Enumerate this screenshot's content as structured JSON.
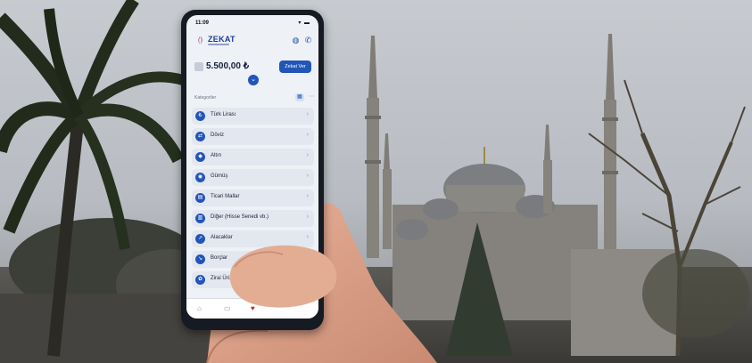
{
  "phone": {
    "status_time": "11:09",
    "status_icons": "▾ ▬",
    "brand": {
      "name": "ZEKAT"
    },
    "header_icons": [
      "globe-icon",
      "phone-icon"
    ],
    "balance": {
      "amount": "5.500,00 ₺",
      "button_label": "Zekat Ver"
    },
    "section_label": "Kategoriler",
    "categories": [
      {
        "label": "Türk Lirası",
        "icon": "lira-icon"
      },
      {
        "label": "Döviz",
        "icon": "currency-exchange-icon"
      },
      {
        "label": "Altın",
        "icon": "gold-icon"
      },
      {
        "label": "Gümüş",
        "icon": "silver-icon"
      },
      {
        "label": "Ticari Mallar",
        "icon": "commercial-goods-icon"
      },
      {
        "label": "Diğer (Hisse Senedi vb.)",
        "icon": "stocks-icon"
      },
      {
        "label": "Alacaklar",
        "icon": "receivables-icon"
      },
      {
        "label": "Borçlar",
        "icon": "debts-icon"
      },
      {
        "label": "Zirai Ürün",
        "icon": "agriculture-icon"
      }
    ],
    "tabbar_icons": [
      "home-icon",
      "calendar-icon",
      "zekat-logo-icon"
    ]
  },
  "colors": {
    "accent": "#2255b8",
    "brand_red": "#c8242b",
    "screen_bg": "#eef1f6"
  }
}
